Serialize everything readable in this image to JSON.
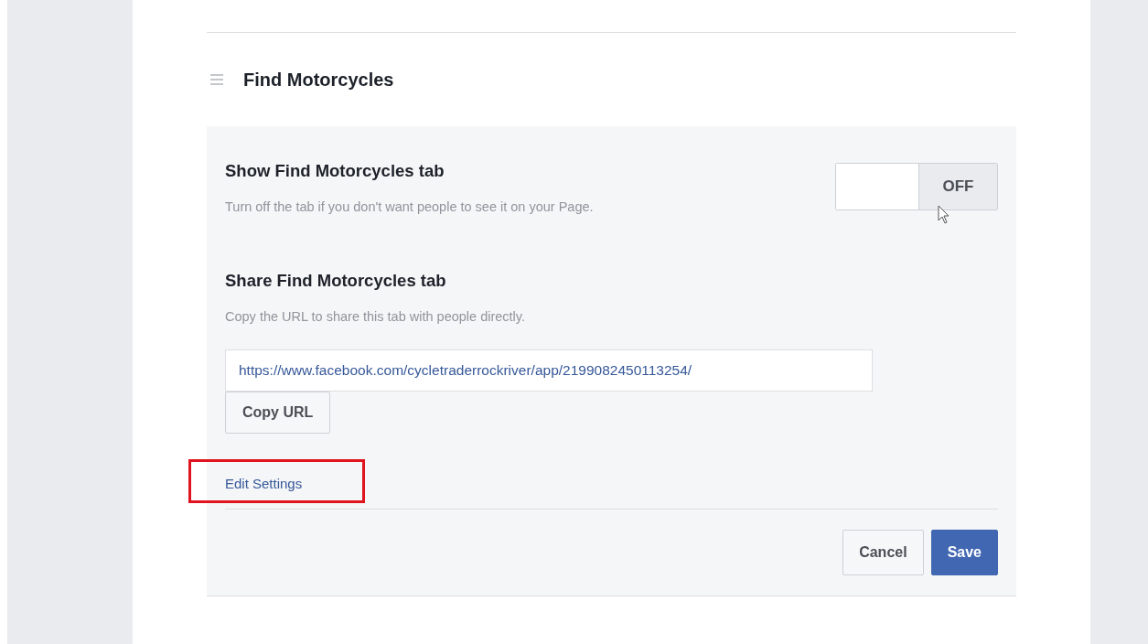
{
  "section": {
    "title": "Find Motorcycles"
  },
  "show_tab": {
    "heading": "Show Find Motorcycles tab",
    "description": "Turn off the tab if you don't want people to see it on your Page.",
    "toggle": {
      "label": "OFF",
      "on": false
    }
  },
  "share_tab": {
    "heading": "Share Find Motorcycles tab",
    "description": "Copy the URL to share this tab with people directly.",
    "url": "https://www.facebook.com/cycletraderrockriver/app/2199082450113254/",
    "copy_button": "Copy URL"
  },
  "edit_link": {
    "label": "Edit Settings",
    "highlighted": true
  },
  "buttons": [
    {
      "label": "Cancel",
      "kind": "secondary"
    },
    {
      "label": "Save",
      "kind": "primary"
    }
  ]
}
